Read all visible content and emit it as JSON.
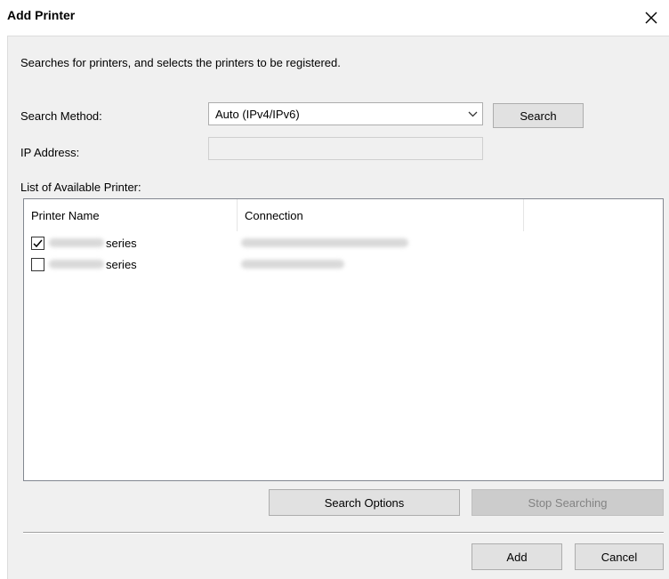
{
  "window": {
    "title": "Add Printer",
    "close_icon": "close-icon"
  },
  "description": "Searches for printers, and selects the printers to be registered.",
  "search_method": {
    "label": "Search Method:",
    "selected": "Auto (IPv4/IPv6)",
    "button": "Search"
  },
  "ip_address": {
    "label": "IP Address:",
    "value": ""
  },
  "list": {
    "label": "List of Available Printer:",
    "columns": [
      "Printer Name",
      "Connection"
    ],
    "rows": [
      {
        "checked": true,
        "name_suffix": "series"
      },
      {
        "checked": false,
        "name_suffix": "series"
      }
    ]
  },
  "buttons": {
    "search_options": "Search Options",
    "stop_searching": "Stop Searching",
    "add": "Add",
    "cancel": "Cancel"
  },
  "colors": {
    "button_bg": "#e1e1e1",
    "disabled_button_bg": "#cccccc",
    "disabled_text": "#838383",
    "client_bg": "#f0f0f0"
  }
}
